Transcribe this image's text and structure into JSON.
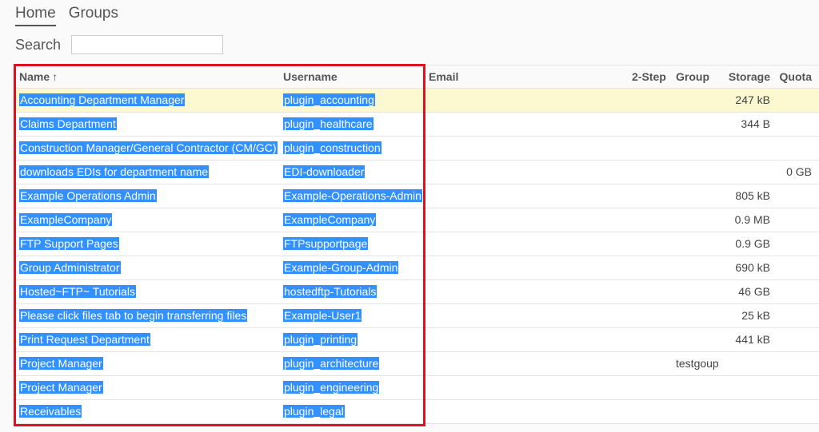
{
  "nav": {
    "home": "Home",
    "groups": "Groups"
  },
  "search": {
    "label": "Search",
    "value": ""
  },
  "columns": {
    "name": "Name",
    "sort_icon": "↑",
    "username": "Username",
    "email": "Email",
    "two_step": "2-Step",
    "group": "Group",
    "storage": "Storage",
    "quota": "Quota"
  },
  "rows": [
    {
      "name": "Accounting Department Manager",
      "username": "plugin_accounting",
      "email": "",
      "two_step": "",
      "group": "",
      "storage": "247 kB",
      "quota": "",
      "highlight": true
    },
    {
      "name": "Claims Department",
      "username": "plugin_healthcare",
      "email": "",
      "two_step": "",
      "group": "",
      "storage": "344 B",
      "quota": ""
    },
    {
      "name": "Construction Manager/General Contractor (CM/GC)",
      "username": "plugin_construction",
      "email": "",
      "two_step": "",
      "group": "",
      "storage": "",
      "quota": ""
    },
    {
      "name": "downloads EDIs for department name",
      "username": "EDI-downloader",
      "email": "",
      "two_step": "",
      "group": "",
      "storage": "",
      "quota": "0 GB"
    },
    {
      "name": "Example Operations Admin",
      "username": "Example-Operations-Admin",
      "email": "",
      "two_step": "",
      "group": "",
      "storage": "805 kB",
      "quota": ""
    },
    {
      "name": "ExampleCompany",
      "username": "ExampleCompany",
      "email": "",
      "two_step": "",
      "group": "",
      "storage": "0.9 MB",
      "quota": ""
    },
    {
      "name": "FTP Support Pages",
      "username": "FTPsupportpage",
      "email": "",
      "two_step": "",
      "group": "",
      "storage": "0.9 GB",
      "quota": ""
    },
    {
      "name": "Group Administrator",
      "username": "Example-Group-Admin",
      "email": "",
      "two_step": "",
      "group": "",
      "storage": "690 kB",
      "quota": ""
    },
    {
      "name": "Hosted~FTP~ Tutorials",
      "username": "hostedftp-Tutorials",
      "email": "",
      "two_step": "",
      "group": "",
      "storage": "46 GB",
      "quota": ""
    },
    {
      "name": "Please click files tab to begin transferring files",
      "username": "Example-User1",
      "email": "",
      "two_step": "",
      "group": "",
      "storage": "25 kB",
      "quota": ""
    },
    {
      "name": "Print Request Department",
      "username": "plugin_printing",
      "email": "",
      "two_step": "",
      "group": "",
      "storage": "441 kB",
      "quota": ""
    },
    {
      "name": "Project Manager",
      "username": "plugin_architecture",
      "email": "",
      "two_step": "",
      "group": "testgoup",
      "storage": "",
      "quota": ""
    },
    {
      "name": "Project Manager",
      "username": "plugin_engineering",
      "email": "",
      "two_step": "",
      "group": "",
      "storage": "",
      "quota": ""
    },
    {
      "name": "Receivables",
      "username": "plugin_legal",
      "email": "",
      "two_step": "",
      "group": "",
      "storage": "",
      "quota": ""
    }
  ],
  "colors": {
    "selection": "#3390ff",
    "highlight_row": "#fcf8d0",
    "annotation_border": "#e0101c"
  }
}
